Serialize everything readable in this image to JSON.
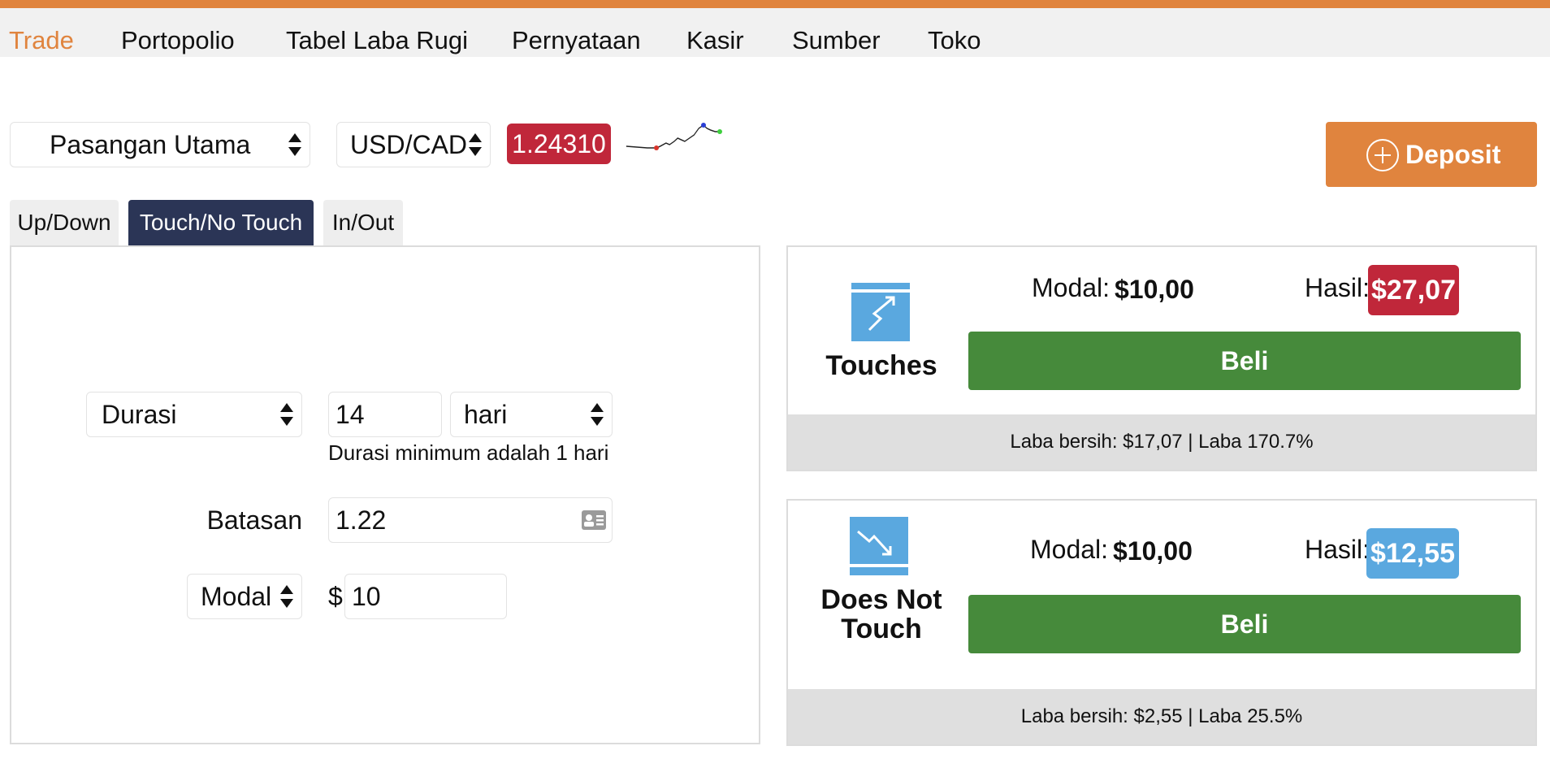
{
  "menu": {
    "items": [
      "Trade",
      "Portopolio",
      "Tabel Laba Rugi",
      "Pernyataan",
      "Kasir",
      "Sumber",
      "Toko"
    ],
    "active_index": 0
  },
  "controls": {
    "pair_group": "Pasangan Utama",
    "pair": "USD/CAD",
    "price": "1.24310",
    "deposit_label": "Deposit"
  },
  "tabs": [
    "Up/Down",
    "Touch/No Touch",
    "In/Out"
  ],
  "active_tab": 1,
  "form": {
    "duration_type": "Durasi",
    "duration_value": "14",
    "duration_unit": "hari",
    "duration_hint": "Durasi minimum adalah 1 hari",
    "barrier_label": "Batasan",
    "barrier_value": "1.22",
    "stake_type": "Modal",
    "currency_symbol": "$",
    "stake_value": "10"
  },
  "contracts": [
    {
      "type_label": "Touches",
      "stake_label": "Modal:",
      "stake_value": "$10,00",
      "payout_label": "Hasil:",
      "payout_value": "$27,07",
      "buy_label": "Beli",
      "summary": "Laba bersih: $17,07 | Laba 170.7%"
    },
    {
      "type_label": "Does Not Touch",
      "stake_label": "Modal:",
      "stake_value": "$10,00",
      "payout_label": "Hasil:",
      "payout_value": "$12,55",
      "buy_label": "Beli",
      "summary": "Laba bersih: $2,55 | Laba 25.5%"
    }
  ],
  "colors": {
    "accent_orange": "#e0843e",
    "price_red": "#c0273a",
    "payout_blue": "#5aa8df",
    "buy_green": "#468a3b",
    "tab_active": "#2b3556"
  },
  "icons": {
    "touch": "touch-up-arrow-icon",
    "no_touch": "no-touch-down-arrow-icon",
    "barrier_picker": "contact-card-icon",
    "deposit": "plus-circle-icon"
  }
}
